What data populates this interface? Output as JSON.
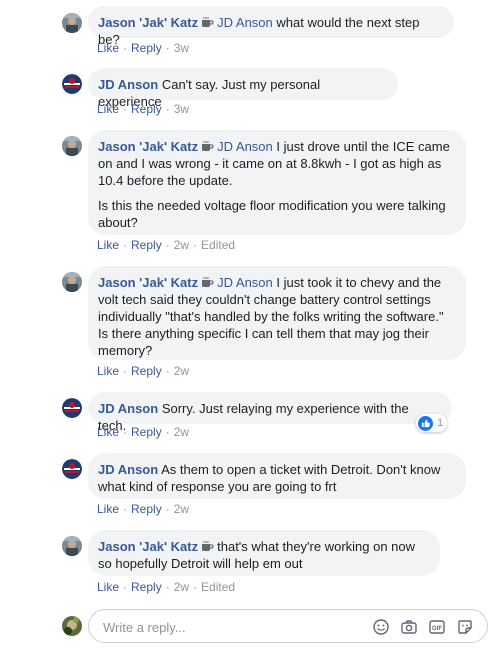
{
  "comments": [
    {
      "author": "Jason 'Jak' Katz",
      "mention": "JD Anson",
      "text": "what would the next step be?",
      "like": "Like",
      "reply": "Reply",
      "time": "3w"
    },
    {
      "author": "JD Anson",
      "text": "Can't say. Just my personal experience",
      "like": "Like",
      "reply": "Reply",
      "time": "3w"
    },
    {
      "author": "Jason 'Jak' Katz",
      "mention": "JD Anson",
      "text": "I just drove until the ICE came on and I was wrong - it came on at 8.8kwh - I got as high as 10.4 before the update.",
      "text2": "Is this the needed voltage floor modification you were talking about?",
      "like": "Like",
      "reply": "Reply",
      "time": "2w",
      "edited": "Edited"
    },
    {
      "author": "Jason 'Jak' Katz",
      "mention": "JD Anson",
      "text": "I just took it to chevy and the volt tech said they couldn't change battery control settings individually \"that's handled by the folks writing the software.\" Is there anything specific I can tell them that may jog their memory?",
      "like": "Like",
      "reply": "Reply",
      "time": "2w"
    },
    {
      "author": "JD Anson",
      "text": "Sorry. Just relaying my experience with the tech.",
      "like": "Like",
      "reply": "Reply",
      "time": "2w",
      "reaction_count": "1"
    },
    {
      "author": "JD Anson",
      "text": "As them to open a ticket with Detroit. Don't know what kind of response you are going to frt",
      "like": "Like",
      "reply": "Reply",
      "time": "2w"
    },
    {
      "author": "Jason 'Jak' Katz",
      "text": "that's what they're working on now so hopefully Detroit will help em out",
      "like": "Like",
      "reply": "Reply",
      "time": "2w",
      "edited": "Edited"
    }
  ],
  "reply_box": {
    "placeholder": "Write a reply...",
    "icons": [
      "emoji-icon",
      "camera-icon",
      "gif-icon",
      "sticker-icon"
    ]
  },
  "colors": {
    "link": "#385898",
    "bubble": "#f2f3f5",
    "meta": "#90949c",
    "like_blue": "#1877f2"
  },
  "separator": "·"
}
